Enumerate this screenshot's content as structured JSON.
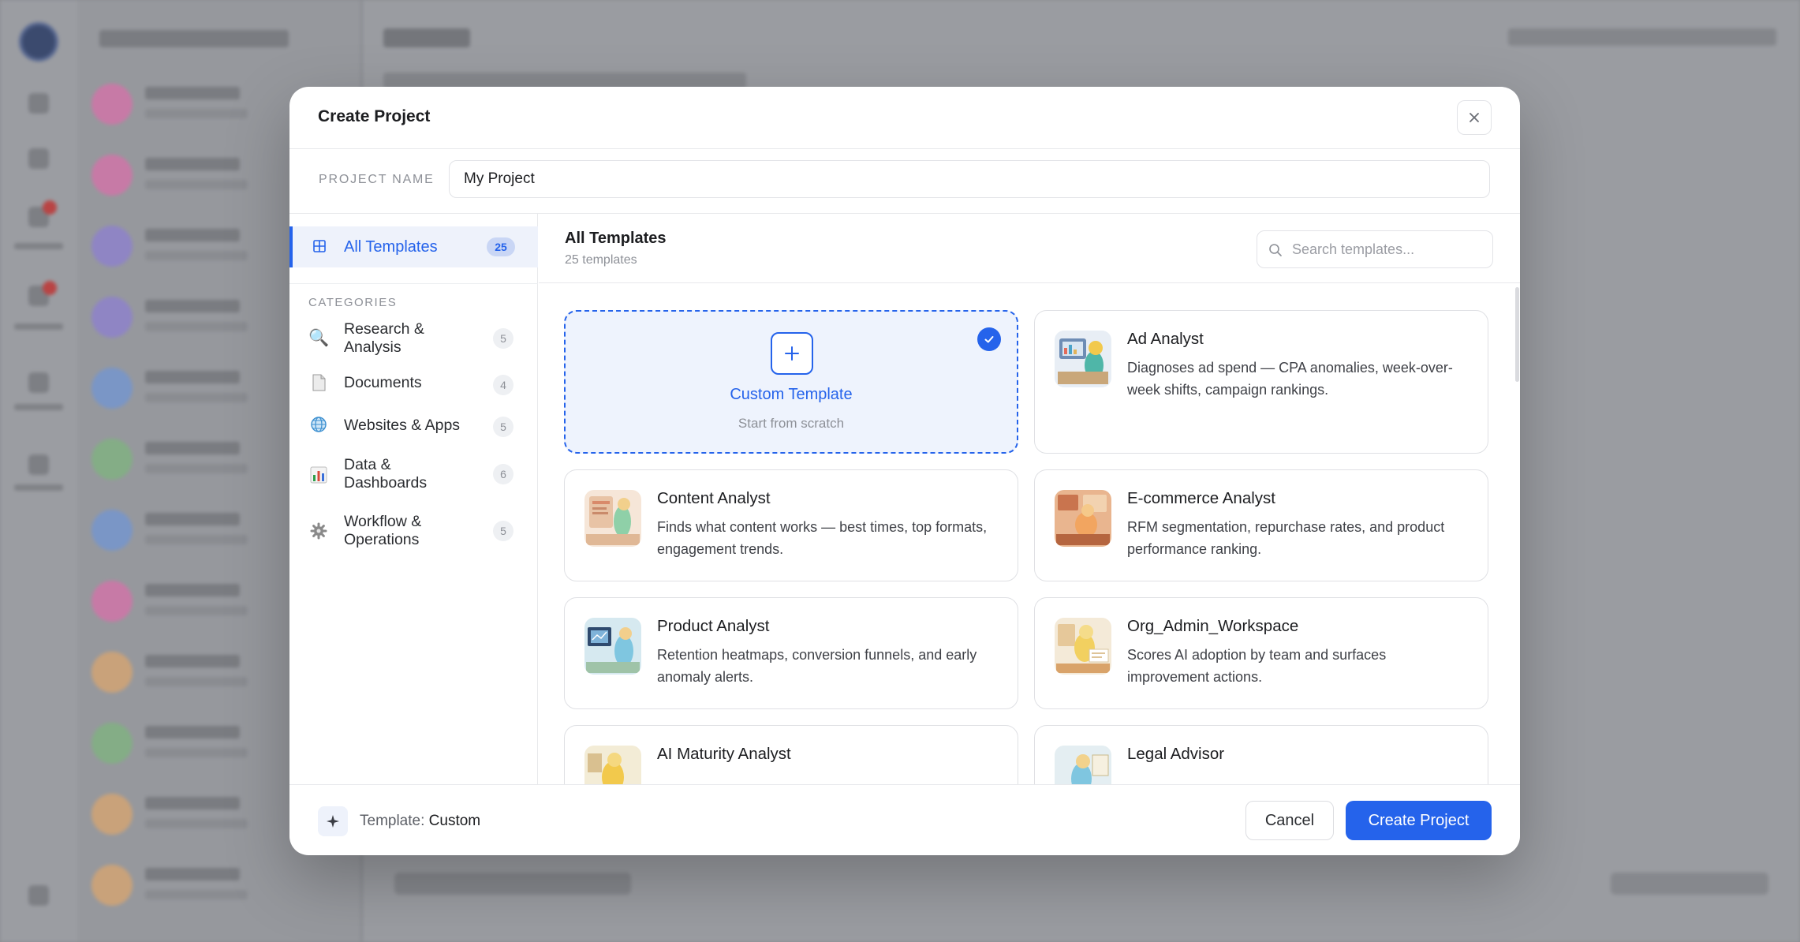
{
  "modal": {
    "title": "Create Project",
    "project_name_label": "PROJECT NAME",
    "project_name_value": "My Project"
  },
  "sidebar": {
    "all_templates": {
      "label": "All Templates",
      "count": "25"
    },
    "categories_title": "CATEGORIES",
    "categories": [
      {
        "label": "Research & Analysis",
        "count": "5",
        "icon": "magnifier-icon"
      },
      {
        "label": "Documents",
        "count": "4",
        "icon": "document-icon"
      },
      {
        "label": "Websites & Apps",
        "count": "5",
        "icon": "globe-icon"
      },
      {
        "label": "Data & Dashboards",
        "count": "6",
        "icon": "bar-chart-icon"
      },
      {
        "label": "Workflow & Operations",
        "count": "5",
        "icon": "gear-icon"
      }
    ]
  },
  "main": {
    "title": "All Templates",
    "subtitle": "25 templates",
    "search_placeholder": "Search templates..."
  },
  "custom_template": {
    "name": "Custom Template",
    "subtitle": "Start from scratch",
    "selected": true
  },
  "templates": [
    {
      "name": "Ad Analyst",
      "desc": "Diagnoses ad spend — CPA anomalies, week-over-week shifts, campaign rankings."
    },
    {
      "name": "Content Analyst",
      "desc": "Finds what content works — best times, top formats, engagement trends."
    },
    {
      "name": "E-commerce Analyst",
      "desc": "RFM segmentation, repurchase rates, and product performance ranking."
    },
    {
      "name": "Product Analyst",
      "desc": "Retention heatmaps, conversion funnels, and early anomaly alerts."
    },
    {
      "name": "Org_Admin_Workspace",
      "desc": "Scores AI adoption by team and surfaces improvement actions."
    },
    {
      "name": "AI Maturity Analyst",
      "desc": ""
    },
    {
      "name": "Legal Advisor",
      "desc": ""
    }
  ],
  "footer": {
    "template_prefix": "Template:",
    "template_value": "Custom",
    "cancel_label": "Cancel",
    "create_label": "Create Project"
  },
  "colors": {
    "accent": "#2563eb",
    "accent_soft": "#eef3fd"
  }
}
